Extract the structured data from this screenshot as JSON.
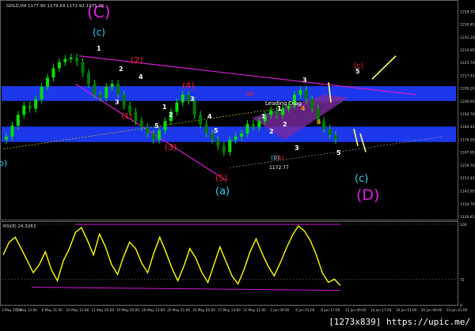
{
  "header": {
    "symbol_line": "GOLD,H4  1177.90 1179.69 1172.92 1175.76"
  },
  "rsi": {
    "header": "RSI(8) 24.3263",
    "level_labels": [
      "100",
      "32",
      "0"
    ],
    "level_values": [
      100,
      32,
      0
    ]
  },
  "watermark": "[1273x839] https://upic.me/",
  "colors": {
    "background": "#000000",
    "bull_candle": "#00e000",
    "bear_candle": "#00e000",
    "zone": "#1f3dff",
    "channel": "#d21cd2",
    "rsi_line": "#ffff00",
    "wave_yellow": "#ffd700",
    "wave_red": "#ff2020",
    "wave_cyan": "#30d0f0",
    "wave_magenta": "#e020e0",
    "leading_diag": "#7a2aa0"
  },
  "chart_data": [
    {
      "type": "candlestick",
      "panel": "price",
      "symbol": "GOLD",
      "timeframe": "H4",
      "ohlc_last": {
        "open": 1177.9,
        "high": 1179.69,
        "low": 1172.92,
        "close": 1175.76
      },
      "ylim": [
        1125.0,
        1265.0
      ],
      "y_ticks": [
        1258.7,
        1250.45,
        1242.2,
        1233.95,
        1225.7,
        1217.45,
        1209.2,
        1200.95,
        1192.7,
        1184.45,
        1176.2,
        1167.95,
        1159.7,
        1151.45,
        1142.95,
        1134.7,
        1126.45
      ],
      "x_ticks": [
        "3 May 2016",
        "5 May 12:00",
        "6 May 21:00",
        "10 May 13:00",
        "11 May 05:00",
        "16 May 05:00",
        "18 May 13:00",
        "20 May 21:00",
        "25 May 05:00",
        "27 May 13:00",
        "31 May 21:00",
        "2 Jun 09:00",
        "6 Jun 01:00",
        "8 Jun 17:00",
        "12 Jun 09:00",
        "14 Jun 17:00",
        "18 Jun 01:00",
        "20 Jun 09:00",
        "24 Jun 01:00"
      ],
      "price_series": [
        [
          1,
          1178
        ],
        [
          2,
          1185
        ],
        [
          3,
          1192
        ],
        [
          4,
          1198
        ],
        [
          5,
          1196
        ],
        [
          6,
          1202
        ],
        [
          7,
          1210
        ],
        [
          8,
          1216
        ],
        [
          9,
          1222
        ],
        [
          10,
          1226
        ],
        [
          11,
          1228
        ],
        [
          12,
          1229
        ],
        [
          13,
          1226
        ],
        [
          14,
          1219
        ],
        [
          15,
          1212
        ],
        [
          16,
          1205
        ],
        [
          17,
          1203
        ],
        [
          18,
          1210
        ],
        [
          19,
          1212
        ],
        [
          20,
          1205
        ],
        [
          21,
          1198
        ],
        [
          22,
          1194
        ],
        [
          23,
          1188
        ],
        [
          24,
          1184
        ],
        [
          25,
          1180
        ],
        [
          26,
          1176
        ],
        [
          27,
          1182
        ],
        [
          28,
          1188
        ],
        [
          29,
          1194
        ],
        [
          30,
          1200
        ],
        [
          31,
          1205
        ],
        [
          32,
          1201
        ],
        [
          33,
          1192
        ],
        [
          34,
          1186
        ],
        [
          35,
          1180
        ],
        [
          36,
          1176
        ],
        [
          37,
          1172
        ],
        [
          38,
          1168
        ],
        [
          39,
          1176
        ],
        [
          40,
          1178
        ],
        [
          41,
          1180
        ],
        [
          42,
          1186
        ],
        [
          43,
          1184
        ],
        [
          44,
          1188
        ],
        [
          45,
          1192
        ],
        [
          46,
          1195
        ],
        [
          47,
          1192
        ],
        [
          48,
          1196
        ],
        [
          49,
          1198
        ],
        [
          50,
          1205
        ],
        [
          51,
          1208
        ],
        [
          52,
          1202
        ],
        [
          53,
          1196
        ],
        [
          54,
          1188
        ],
        [
          55,
          1183
        ],
        [
          56,
          1179
        ],
        [
          57,
          1176
        ]
      ],
      "zones": [
        {
          "low": 1200.95,
          "high": 1210.5
        },
        {
          "low": 1174.5,
          "high": 1184.45
        }
      ],
      "annotations": [
        {
          "text": "(C)",
          "color": "magenta"
        },
        {
          "text": "(c)",
          "color": "cyan"
        },
        {
          "text": "(2)",
          "color": "red"
        },
        {
          "text": "(4)",
          "color": "red"
        },
        {
          "text": "(1)",
          "color": "red"
        },
        {
          "text": "(3)",
          "color": "red"
        },
        {
          "text": "(5)",
          "color": "red"
        },
        {
          "text": "(a)",
          "color": "cyan"
        },
        {
          "text": "(b)",
          "color": "cyan"
        },
        {
          "text": "(c)",
          "color": "cyan"
        },
        {
          "text": "(D)",
          "color": "magenta"
        },
        {
          "text": "(a)",
          "color": "red"
        },
        {
          "text": "(b)",
          "color": "red"
        },
        {
          "text": "(c)",
          "color": "red"
        },
        {
          "text": "Leading Diag",
          "color": "white"
        },
        {
          "text": "1172.77",
          "color": "white"
        },
        {
          "text": "b)",
          "color": "cyan"
        }
      ],
      "wave_labels_yellow": [
        "1",
        "2",
        "3",
        "4",
        "5",
        "1",
        "2",
        "3",
        "4",
        "5",
        "1",
        "2",
        "3",
        "4",
        "5",
        "1",
        "2",
        "3",
        "4",
        "5"
      ]
    },
    {
      "type": "line",
      "panel": "rsi",
      "name": "RSI(8)",
      "last_value": 24.3263,
      "ylim": [
        0,
        100
      ],
      "levels": [
        100,
        32,
        0
      ],
      "values": [
        62,
        78,
        84,
        70,
        55,
        40,
        50,
        66,
        44,
        30,
        55,
        70,
        90,
        96,
        80,
        62,
        88,
        72,
        50,
        38,
        60,
        78,
        70,
        52,
        40,
        64,
        84,
        66,
        46,
        30,
        48,
        70,
        58,
        40,
        28,
        50,
        72,
        54,
        36,
        26,
        44,
        66,
        82,
        64,
        48,
        36,
        52,
        70,
        86,
        98,
        92,
        80,
        62,
        40,
        28,
        32,
        24
      ]
    }
  ]
}
